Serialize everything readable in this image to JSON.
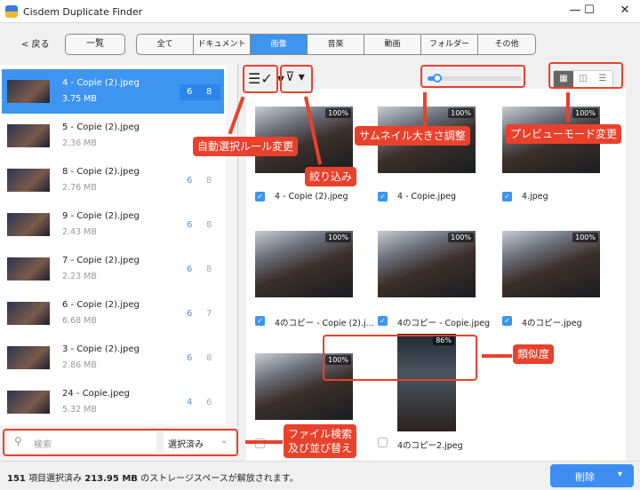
{
  "window": {
    "title": "Cisdem Duplicate Finder",
    "minimize": "—",
    "maximize": "☐",
    "close": "✕"
  },
  "toolbar": {
    "back": "< 戻る",
    "list": "一覧",
    "tabs": [
      "全て",
      "ドキュメント",
      "画像",
      "音楽",
      "動画",
      "フォルダー",
      "その他"
    ],
    "active_tab": "画像"
  },
  "left_list": [
    {
      "name": "4 - Copie (2).jpeg",
      "size": "3.75 MB",
      "a": "6",
      "b": "8",
      "selected": true
    },
    {
      "name": "5 - Copie (2).jpeg",
      "size": "2.36 MB",
      "a": "",
      "b": ""
    },
    {
      "name": "8 - Copie (2).jpeg",
      "size": "2.76 MB",
      "a": "6",
      "b": "8"
    },
    {
      "name": "9 - Copie (2).jpeg",
      "size": "2.43 MB",
      "a": "6",
      "b": "8"
    },
    {
      "name": "7 - Copie (2).jpeg",
      "size": "2.23 MB",
      "a": "6",
      "b": "8"
    },
    {
      "name": "6 - Copie (2).jpeg",
      "size": "6.68 MB",
      "a": "6",
      "b": "7"
    },
    {
      "name": "3 - Copie (2).jpeg",
      "size": "2.86 MB",
      "a": "6",
      "b": "8"
    },
    {
      "name": "24 - Copie.jpeg",
      "size": "5.32 MB",
      "a": "4",
      "b": "6"
    }
  ],
  "search": {
    "placeholder": "検索",
    "sort": "選択済み"
  },
  "preview": {
    "slider_value": 0.1,
    "view_mode": "grid"
  },
  "grid": [
    {
      "label": "4 - Copie (2).jpeg",
      "similarity": "100%",
      "checked": true
    },
    {
      "label": "4 - Copie.jpeg",
      "similarity": "100%",
      "checked": true
    },
    {
      "label": "4.jpeg",
      "similarity": "100%",
      "checked": true
    },
    {
      "label": "4のコピー - Copie (2).j...",
      "similarity": "100%",
      "checked": true
    },
    {
      "label": "4のコピー - Copie.jpeg",
      "similarity": "100%",
      "checked": true
    },
    {
      "label": "4のコピー.jpeg",
      "similarity": "100%",
      "checked": true
    },
    {
      "label": "",
      "similarity": "100%",
      "checked": false
    },
    {
      "label": "4のコピー2.jpeg",
      "similarity": "86%",
      "checked": false
    }
  ],
  "status": {
    "count": "151",
    "count_label": "項目選択済み",
    "size": "213.95 MB",
    "message": "のストレージスペースが解放されます。",
    "delete": "削除"
  },
  "annotations": {
    "auto_select": "自動選択ルール変更",
    "filter": "絞り込み",
    "thumb_size": "サムネイル大きさ調整",
    "preview_mode": "プレビューモード変更",
    "similarity": "類似度",
    "search_sort": "ファイル検索\n及び並び替え"
  },
  "colors": {
    "accent": "#3d95f0",
    "annotation": "#e8412c"
  }
}
